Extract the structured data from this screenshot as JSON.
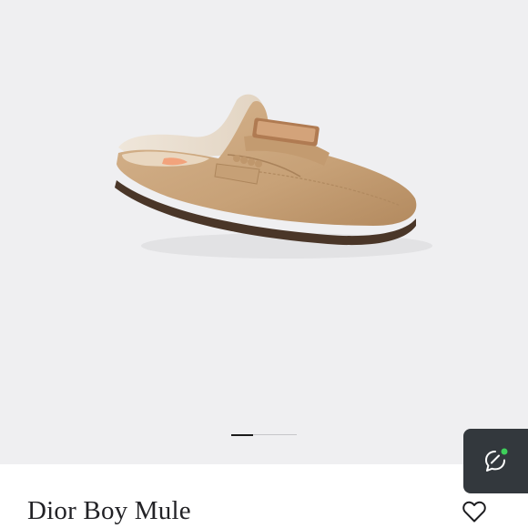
{
  "product": {
    "name": "Dior Boy Mule",
    "image_icon": "suede-mule-shoe-image"
  },
  "gallery": {
    "current_slide": 1,
    "total_slides": 3
  },
  "wishlist": {
    "icon": "heart-outline-icon"
  },
  "chat": {
    "icon": "chat-bubble-icon",
    "status_color": "#3ecf5a",
    "online": true
  },
  "colors": {
    "background": "#efeff1",
    "chat_button": "#33383d",
    "text": "#222226"
  }
}
